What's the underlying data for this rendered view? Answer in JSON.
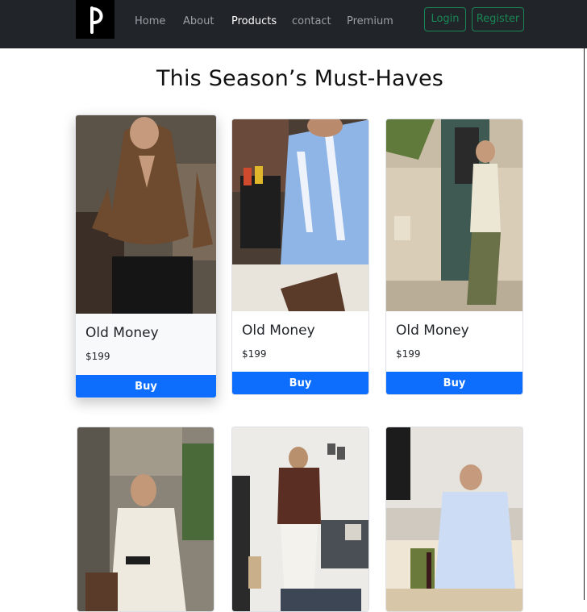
{
  "nav": {
    "logo_icon": "pinterest-logo-icon",
    "links": [
      "Home",
      "About",
      "Products",
      "contact",
      "Premium"
    ],
    "active": "Products",
    "login_label": "Login",
    "register_label": "Register"
  },
  "page": {
    "title": "This Season’s Must-Haves"
  },
  "products": [
    {
      "title": "Old Money",
      "price": "$199",
      "button": "Buy"
    },
    {
      "title": "Old Money",
      "price": "$199",
      "button": "Buy"
    },
    {
      "title": "Old Money",
      "price": "$199",
      "button": "Buy"
    }
  ],
  "colors": {
    "navbar": "#212529",
    "accent_green": "#198754",
    "buy_blue": "#0d6efd"
  }
}
